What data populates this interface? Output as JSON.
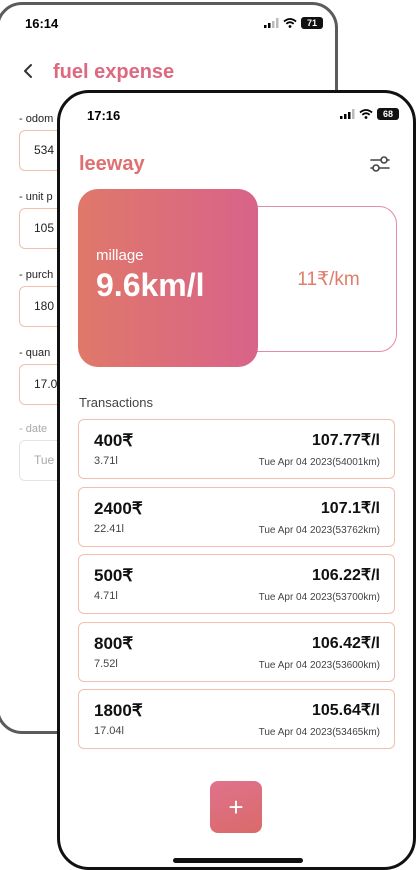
{
  "back_screen": {
    "status_time": "16:14",
    "battery": "71",
    "title": "fuel expense",
    "fields": [
      {
        "label": "- odom",
        "value": "534"
      },
      {
        "label": "- unit p",
        "value": "105"
      },
      {
        "label": "- purch",
        "value": "180"
      },
      {
        "label": "- quan",
        "value": "17.0"
      },
      {
        "label": "- date",
        "value": "Tue"
      }
    ]
  },
  "front_screen": {
    "status_time": "17:16",
    "battery": "68",
    "app_title": "leeway",
    "mileage": {
      "label": "millage",
      "value": "9.6km/l"
    },
    "cost_per_km": "11₹/km",
    "transactions_label": "Transactions",
    "transactions": [
      {
        "amount": "400₹",
        "quantity": "3.71l",
        "rate": "107.77₹/l",
        "meta": "Tue Apr 04 2023(54001km)"
      },
      {
        "amount": "2400₹",
        "quantity": "22.41l",
        "rate": "107.1₹/l",
        "meta": "Tue Apr 04 2023(53762km)"
      },
      {
        "amount": "500₹",
        "quantity": "4.71l",
        "rate": "106.22₹/l",
        "meta": "Tue Apr 04 2023(53700km)"
      },
      {
        "amount": "800₹",
        "quantity": "7.52l",
        "rate": "106.42₹/l",
        "meta": "Tue Apr 04 2023(53600km)"
      },
      {
        "amount": "1800₹",
        "quantity": "17.04l",
        "rate": "105.64₹/l",
        "meta": "Tue Apr 04 2023(53465km)"
      }
    ],
    "fab_label": "+"
  },
  "colors": {
    "accent_pink": "#dd6880",
    "gradient_start": "#e0786a",
    "gradient_end": "#d8638a",
    "card_border": "#f0bfae"
  },
  "icons": [
    "back-chevron-icon",
    "filter-sliders-icon",
    "signal-icon",
    "wifi-icon",
    "battery-icon",
    "plus-icon"
  ]
}
